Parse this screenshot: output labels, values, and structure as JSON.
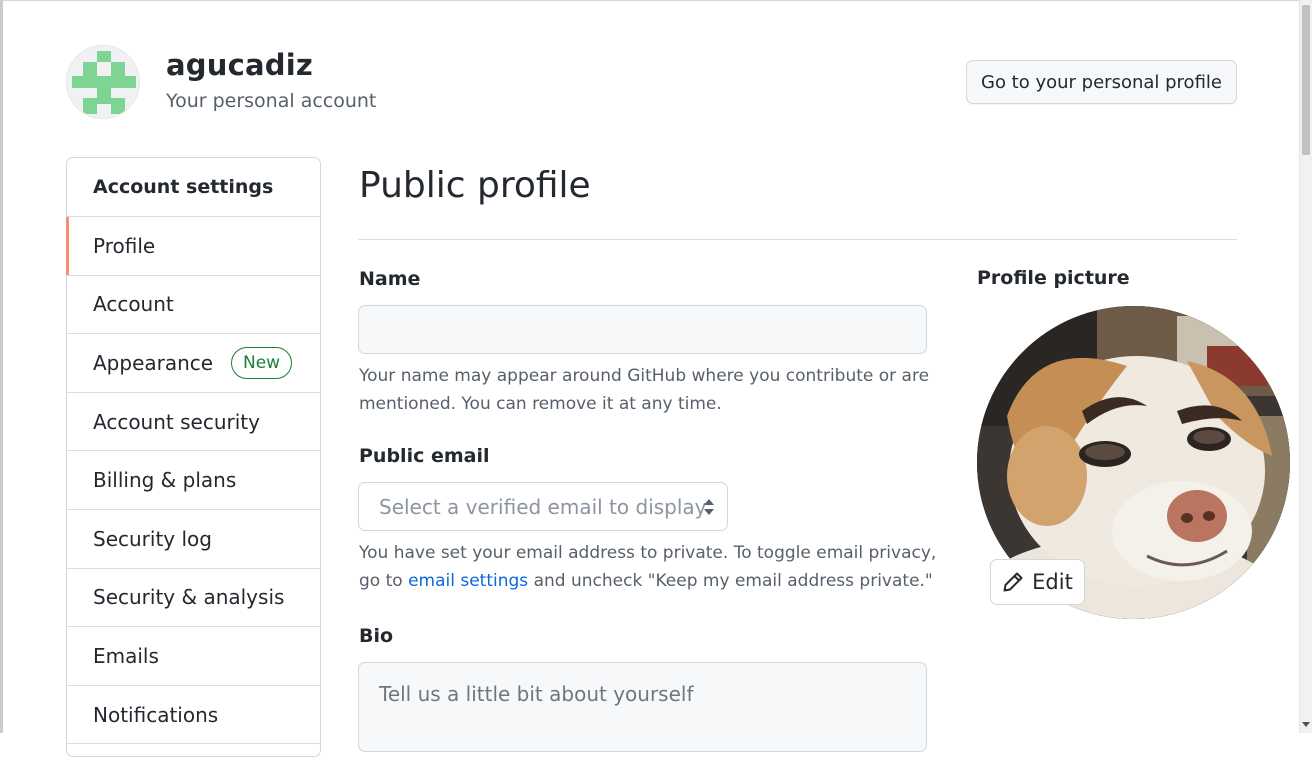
{
  "header": {
    "username": "agucadiz",
    "subtitle": "Your personal account",
    "personal_profile_button": "Go to your personal profile"
  },
  "sidebar": {
    "heading": "Account settings",
    "items": [
      {
        "label": "Profile",
        "active": true
      },
      {
        "label": "Account"
      },
      {
        "label": "Appearance",
        "badge": "New"
      },
      {
        "label": "Account security"
      },
      {
        "label": "Billing & plans"
      },
      {
        "label": "Security log"
      },
      {
        "label": "Security & analysis"
      },
      {
        "label": "Emails"
      },
      {
        "label": "Notifications"
      }
    ]
  },
  "main": {
    "title": "Public profile",
    "name": {
      "label": "Name",
      "value": "",
      "note": "Your name may appear around GitHub where you contribute or are mentioned. You can remove it at any time."
    },
    "public_email": {
      "label": "Public email",
      "placeholder": "Select a verified email to display",
      "note_before": "You have set your email address to private. To toggle email privacy, go to ",
      "note_link": "email settings",
      "note_after": " and uncheck \"Keep my email address private.\""
    },
    "bio": {
      "label": "Bio",
      "placeholder": "Tell us a little bit about yourself"
    },
    "profile_picture": {
      "label": "Profile picture",
      "edit_label": "Edit"
    }
  },
  "colors": {
    "accent_active": "#fd8c73",
    "badge_green": "#1a7f37",
    "link_blue": "#0969da",
    "identicon_green": "#7ed492"
  },
  "icons": [
    "identicon-avatar",
    "select-arrows-icon",
    "pencil-icon"
  ]
}
